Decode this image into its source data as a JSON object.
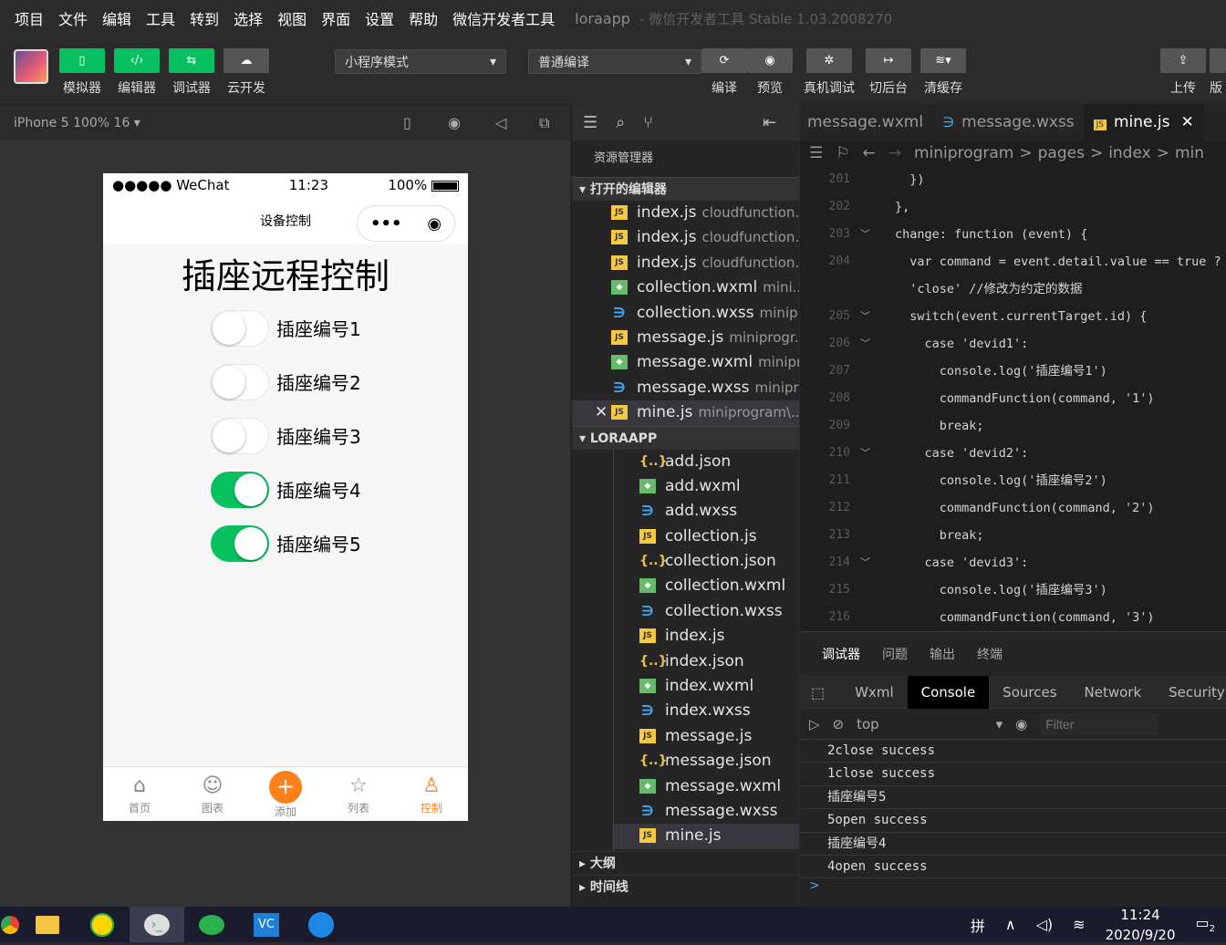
{
  "menubar": {
    "items": [
      "项目",
      "文件",
      "编辑",
      "工具",
      "转到",
      "选择",
      "视图",
      "界面",
      "设置",
      "帮助",
      "微信开发者工具"
    ],
    "app_name": "loraapp",
    "app_version": "- 微信开发者工具 Stable 1.03.2008270"
  },
  "toolbar": {
    "simulator": "模拟器",
    "editor": "编辑器",
    "debugger": "调试器",
    "cloud": "云开发",
    "mode_select": "小程序模式",
    "compile_select": "普通编译",
    "compile": "编译",
    "preview": "预览",
    "real_debug": "真机调试",
    "background": "切后台",
    "clear_cache": "清缓存",
    "upload": "上传",
    "version": "版"
  },
  "simulator": {
    "device": "iPhone 5 100% 16 ▾",
    "status_carrier": "●●●●● WeChat",
    "status_time": "11:23",
    "status_battery": "100%",
    "nav_title": "设备控制",
    "page_title": "插座远程控制",
    "switches": [
      {
        "label": "插座编号1",
        "on": false
      },
      {
        "label": "插座编号2",
        "on": false
      },
      {
        "label": "插座编号3",
        "on": false
      },
      {
        "label": "插座编号4",
        "on": true
      },
      {
        "label": "插座编号5",
        "on": true
      }
    ],
    "tabbar": [
      "首页",
      "图表",
      "添加",
      "列表",
      "控制"
    ]
  },
  "explorer": {
    "title": "资源管理器",
    "open_editors": "打开的编辑器",
    "project": "LORAAPP",
    "open_files": [
      {
        "name": "index.js",
        "path": "cloudfunction...",
        "type": "js"
      },
      {
        "name": "index.js",
        "path": "cloudfunction...",
        "type": "js"
      },
      {
        "name": "index.js",
        "path": "cloudfunction...",
        "type": "js"
      },
      {
        "name": "collection.wxml",
        "path": "mini...",
        "type": "wxml"
      },
      {
        "name": "collection.wxss",
        "path": "minip...",
        "type": "wxss"
      },
      {
        "name": "message.js",
        "path": "miniprogr...",
        "type": "js"
      },
      {
        "name": "message.wxml",
        "path": "minipr...",
        "type": "wxml"
      },
      {
        "name": "message.wxss",
        "path": "minipr...",
        "type": "wxss"
      },
      {
        "name": "mine.js",
        "path": "miniprogram\\...",
        "type": "js"
      }
    ],
    "tree": [
      {
        "name": "add.json",
        "type": "json"
      },
      {
        "name": "add.wxml",
        "type": "wxml"
      },
      {
        "name": "add.wxss",
        "type": "wxss"
      },
      {
        "name": "collection.js",
        "type": "js"
      },
      {
        "name": "collection.json",
        "type": "json"
      },
      {
        "name": "collection.wxml",
        "type": "wxml"
      },
      {
        "name": "collection.wxss",
        "type": "wxss"
      },
      {
        "name": "index.js",
        "type": "js"
      },
      {
        "name": "index.json",
        "type": "json"
      },
      {
        "name": "index.wxml",
        "type": "wxml"
      },
      {
        "name": "index.wxss",
        "type": "wxss"
      },
      {
        "name": "message.js",
        "type": "js"
      },
      {
        "name": "message.json",
        "type": "json"
      },
      {
        "name": "message.wxml",
        "type": "wxml"
      },
      {
        "name": "message.wxss",
        "type": "wxss"
      },
      {
        "name": "mine.js",
        "type": "js"
      }
    ],
    "outline": "大纲",
    "timeline": "时间线"
  },
  "editor": {
    "tabs": [
      "message.wxml",
      "message.wxss",
      "mine.js"
    ],
    "breadcrumbs": [
      "miniprogram",
      ">",
      "pages",
      ">",
      "index",
      ">",
      "min"
    ],
    "lines": [
      {
        "n": "201",
        "code": "  })"
      },
      {
        "n": "202",
        "code": "},"
      },
      {
        "n": "203",
        "code": "change: function (event) {"
      },
      {
        "n": "204",
        "code": "  var command = event.detail.value == true ?"
      },
      {
        "n": "",
        "code": "  'close' //修改为约定的数据"
      },
      {
        "n": "205",
        "code": "  switch(event.currentTarget.id) {"
      },
      {
        "n": "206",
        "code": "    case 'devid1':"
      },
      {
        "n": "207",
        "code": "      console.log('插座编号1')"
      },
      {
        "n": "208",
        "code": "      commandFunction(command, '1')"
      },
      {
        "n": "209",
        "code": "      break;"
      },
      {
        "n": "210",
        "code": "    case 'devid2':"
      },
      {
        "n": "211",
        "code": "      console.log('插座编号2')"
      },
      {
        "n": "212",
        "code": "      commandFunction(command, '2')"
      },
      {
        "n": "213",
        "code": "      break;"
      },
      {
        "n": "214",
        "code": "    case 'devid3':"
      },
      {
        "n": "215",
        "code": "      console.log('插座编号3')"
      },
      {
        "n": "216",
        "code": "      commandFunction(command, '3')"
      }
    ]
  },
  "debugger": {
    "tabs": [
      "调试器",
      "问题",
      "输出",
      "终端"
    ],
    "devtools_tabs": [
      "Wxml",
      "Console",
      "Sources",
      "Network",
      "Security"
    ],
    "context": "top",
    "filter_placeholder": "Filter",
    "console_lines": [
      "2close success",
      "1close success",
      "插座编号5",
      "5open success",
      "插座编号4",
      "4open success"
    ],
    "prompt": ">"
  },
  "taskbar": {
    "time": "11:24",
    "date": "2020/9/20",
    "ime": "拼",
    "notification_count": "2"
  }
}
